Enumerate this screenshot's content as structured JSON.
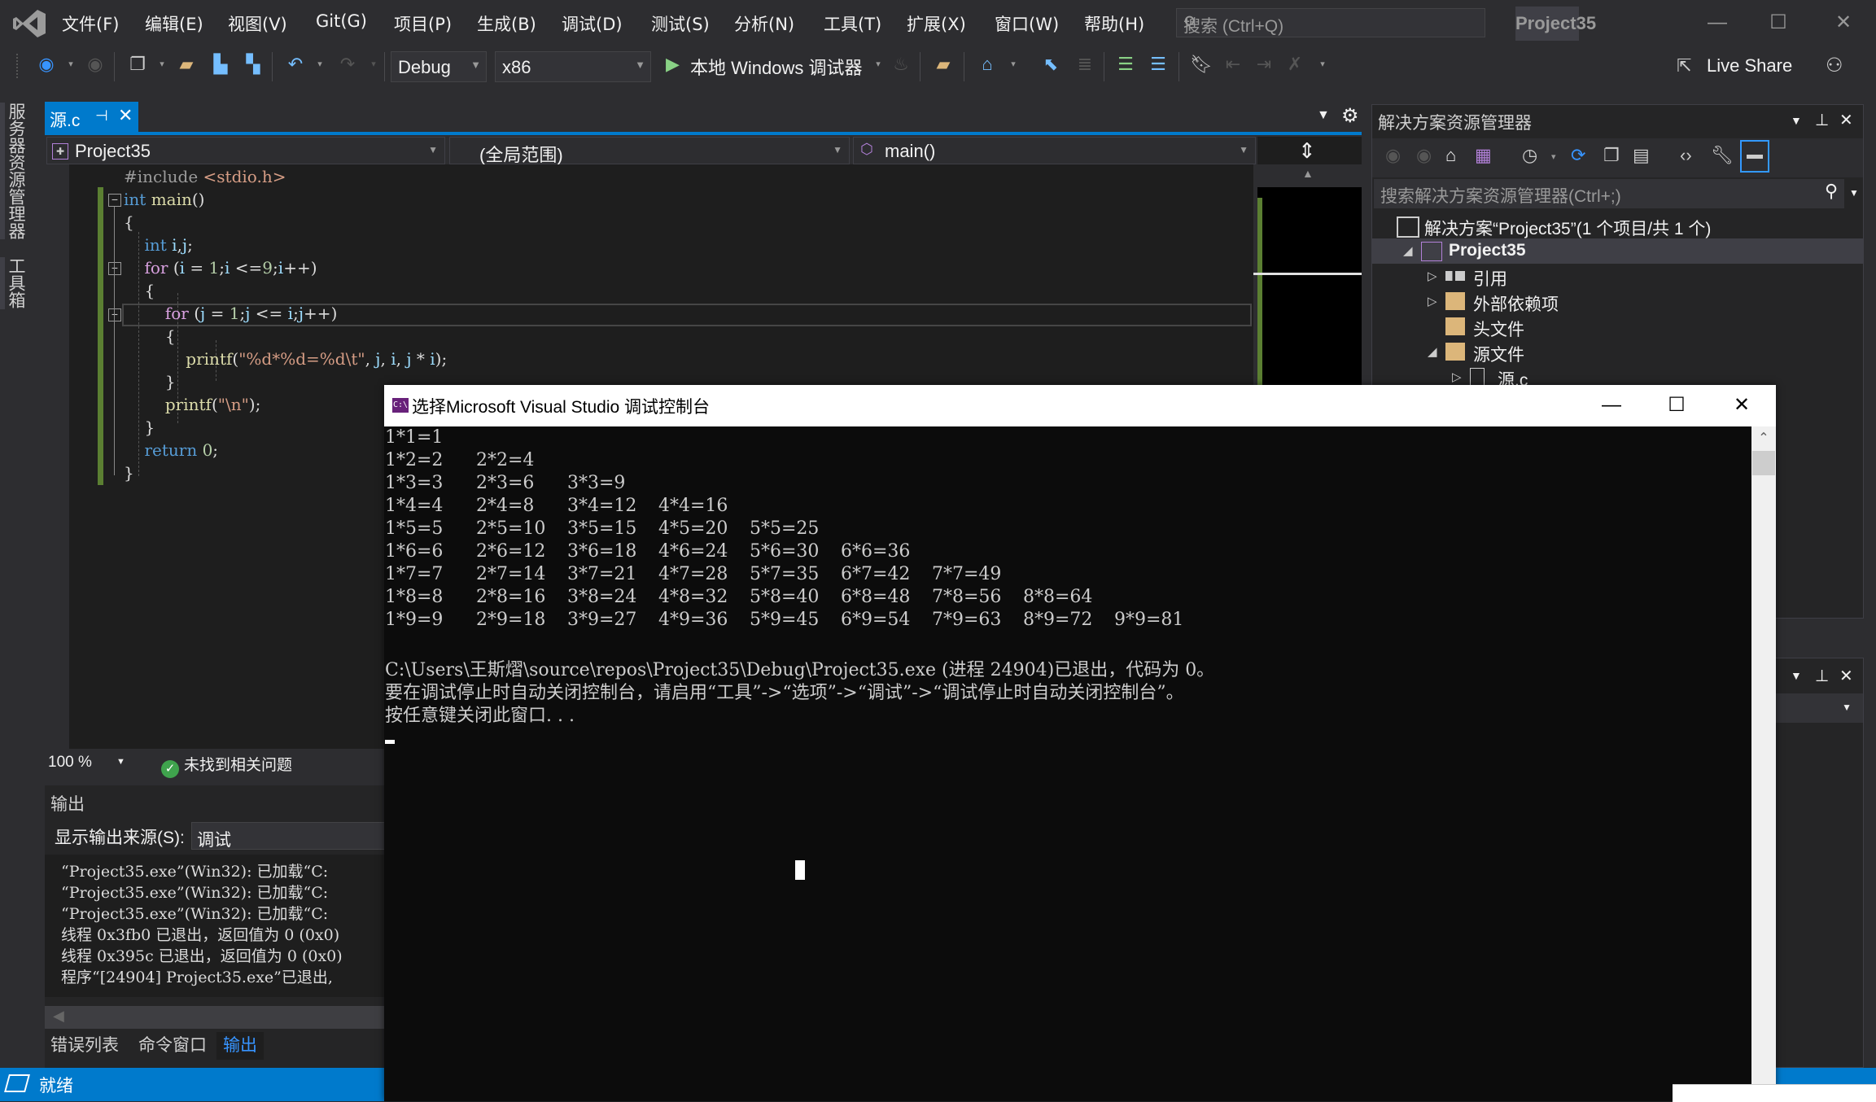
{
  "menubar": {
    "items": [
      "文件(F)",
      "编辑(E)",
      "视图(V)",
      "Git(G)",
      "项目(P)",
      "生成(B)",
      "调试(D)",
      "测试(S)",
      "分析(N)",
      "工具(T)",
      "扩展(X)",
      "窗口(W)",
      "帮助(H)"
    ],
    "search_placeholder": "搜索 (Ctrl+Q)",
    "solution_title": "Project35"
  },
  "toolbar": {
    "configuration": "Debug",
    "platform": "x86",
    "run_label": "本地 Windows 调试器",
    "live_share": "Live Share"
  },
  "left_strip": {
    "tabs": [
      "服务器资源管理器",
      "工具箱"
    ]
  },
  "editor": {
    "tab_name": "源.c",
    "nav_project": "Project35",
    "nav_scope": "(全局范围)",
    "nav_member": "main()",
    "code": [
      "#include <stdio.h>",
      "int main()",
      "{",
      "    int i,j;",
      "    for (i = 1;i <=9;i++)",
      "    {",
      "        for (j = 1;j <= i;j++)",
      "        {",
      "            printf(\"%d*%d=%d\\t\", j, i, j * i);",
      "        }",
      "        printf(\"\\n\");",
      "    }",
      "    return 0;",
      "}"
    ],
    "zoom_level": "100 %",
    "issues_status": "未找到相关问题"
  },
  "output_panel": {
    "title": "输出",
    "source_label": "显示输出来源(S):",
    "source_value": "调试",
    "lines": [
      "“Project35.exe”(Win32): 已加载“C:",
      "“Project35.exe”(Win32): 已加载“C:",
      "“Project35.exe”(Win32): 已加载“C:",
      "线程 0x3fb0 已退出，返回值为 0 (0x0)",
      "线程 0x395c 已退出，返回值为 0 (0x0)",
      "程序“[24904] Project35.exe”已退出,"
    ],
    "tabs": [
      "错误列表",
      "命令窗口",
      "输出"
    ],
    "active_tab": "输出"
  },
  "statusbar": {
    "text": "就绪"
  },
  "solution_explorer": {
    "title": "解决方案资源管理器",
    "search_placeholder": "搜索解决方案资源管理器(Ctrl+;)",
    "tree": [
      {
        "label": "解决方案“Project35”(1 个项目/共 1 个)",
        "level": 0,
        "expander": "",
        "icon": "solution-icon"
      },
      {
        "label": "Project35",
        "level": 1,
        "expander": "◢",
        "icon": "cpp-project-icon",
        "bold": true,
        "selected": true
      },
      {
        "label": "引用",
        "level": 2,
        "expander": "▷",
        "icon": "references-icon"
      },
      {
        "label": "外部依赖项",
        "level": 2,
        "expander": "▷",
        "icon": "external-deps-icon"
      },
      {
        "label": "头文件",
        "level": 2,
        "expander": "",
        "icon": "filter-folder-icon"
      },
      {
        "label": "源文件",
        "level": 2,
        "expander": "◢",
        "icon": "filter-folder-open-icon"
      },
      {
        "label": "源.c",
        "level": 3,
        "expander": "▷",
        "icon": "c-file-icon"
      }
    ]
  },
  "console": {
    "title": "选择Microsoft Visual Studio 调试控制台",
    "icon_text": "C:\\",
    "table": [
      [
        "1*1=1"
      ],
      [
        "1*2=2",
        "2*2=4"
      ],
      [
        "1*3=3",
        "2*3=6",
        "3*3=9"
      ],
      [
        "1*4=4",
        "2*4=8",
        "3*4=12",
        "4*4=16"
      ],
      [
        "1*5=5",
        "2*5=10",
        "3*5=15",
        "4*5=20",
        "5*5=25"
      ],
      [
        "1*6=6",
        "2*6=12",
        "3*6=18",
        "4*6=24",
        "5*6=30",
        "6*6=36"
      ],
      [
        "1*7=7",
        "2*7=14",
        "3*7=21",
        "4*7=28",
        "5*7=35",
        "6*7=42",
        "7*7=49"
      ],
      [
        "1*8=8",
        "2*8=16",
        "3*8=24",
        "4*8=32",
        "5*8=40",
        "6*8=48",
        "7*8=56",
        "8*8=64"
      ],
      [
        "1*9=9",
        "2*9=18",
        "3*9=27",
        "4*9=36",
        "5*9=45",
        "6*9=54",
        "7*9=63",
        "8*9=72",
        "9*9=81"
      ]
    ],
    "exit_line": "C:\\Users\\王斯熠\\source\\repos\\Project35\\Debug\\Project35.exe (进程 24904)已退出，代码为 0。",
    "hint_line": "要在调试停止时自动关闭控制台，请启用“工具”->“选项”->“调试”->“调试停止时自动关闭控制台”。",
    "press_key_line": "按任意键关闭此窗口. . ."
  },
  "colors": {
    "accent": "#007acc",
    "background": "#2d2d30",
    "editor_bg": "#1e1e1e",
    "console_bg": "#0c0c0c",
    "change_bar": "#5b7f32"
  }
}
